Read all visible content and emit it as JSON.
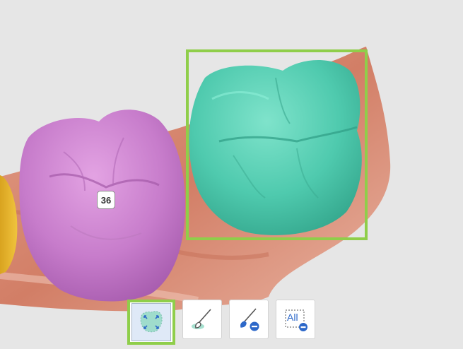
{
  "scene": {
    "tooth_number": "36"
  },
  "toolbar": {
    "buttons": [
      {
        "name": "auto-segment",
        "active": true
      },
      {
        "name": "paint-brush",
        "active": false
      },
      {
        "name": "erase-brush",
        "active": false
      },
      {
        "name": "clear-all",
        "label": "All",
        "active": false
      }
    ]
  },
  "colors": {
    "background": "#e6e6e6",
    "selected_tooth": "#55d1b5",
    "adjacent_tooth": "#cf7fd3",
    "neighbor_tooth": "#e3b82e",
    "gum": "#d98a73",
    "selection_border": "#8fce4a",
    "active_button": "#dfe9f7",
    "icon_blue": "#2d68c9"
  }
}
